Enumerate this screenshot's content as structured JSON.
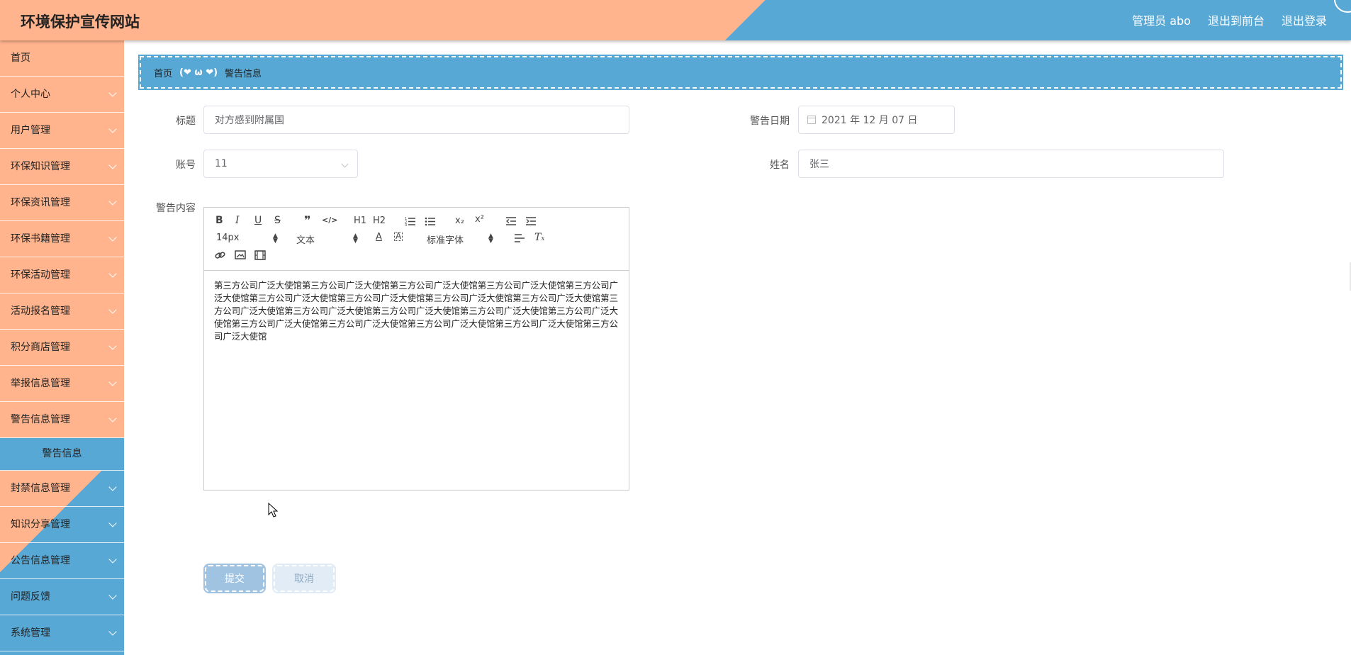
{
  "header": {
    "brand": "环境保护宣传网站",
    "user": "管理员 abo",
    "to_front": "退出到前台",
    "logout": "退出登录"
  },
  "sidebar": {
    "home": "首页",
    "items": [
      "个人中心",
      "用户管理",
      "环保知识管理",
      "环保资讯管理",
      "环保书籍管理",
      "环保活动管理",
      "活动报名管理",
      "积分商店管理",
      "举报信息管理",
      "警告信息管理"
    ],
    "active_sub": "警告信息",
    "items_after": [
      "封禁信息管理",
      "知识分享管理",
      "公告信息管理",
      "问题反馈",
      "系统管理"
    ]
  },
  "breadcrumb": {
    "home": "首页",
    "sep": "(❤ ω ❤)",
    "current": "警告信息"
  },
  "form": {
    "title_label": "标题",
    "title_value": "对方感到附属国",
    "date_label": "警告日期",
    "date_value": "2021 年 12 月 07 日",
    "account_label": "账号",
    "account_value": "11",
    "name_label": "姓名",
    "name_value": "张三",
    "content_label": "警告内容"
  },
  "editor": {
    "toolbar": {
      "bold": "B",
      "italic": "I",
      "underline": "U",
      "strike": "S",
      "quote": "❞",
      "code": "</>",
      "h1": "H1",
      "h2": "H2",
      "sub": "x₂",
      "sup": "x²",
      "size": "14px",
      "header_picker": "文本",
      "font_picker": "标准字体"
    },
    "content": "第三方公司广泛大使馆第三方公司广泛大使馆第三方公司广泛大使馆第三方公司广泛大使馆第三方公司广泛大使馆第三方公司广泛大使馆第三方公司广泛大使馆第三方公司广泛大使馆第三方公司广泛大使馆第三方公司广泛大使馆第三方公司广泛大使馆第三方公司广泛大使馆第三方公司广泛大使馆第三方公司广泛大使馆第三方公司广泛大使馆第三方公司广泛大使馆第三方公司广泛大使馆第三方公司广泛大使馆第三方公司广泛大使馆"
  },
  "buttons": {
    "submit": "提交",
    "cancel": "取消"
  },
  "colors": {
    "peach": "#ffb48e",
    "blue": "#58a8d6"
  }
}
